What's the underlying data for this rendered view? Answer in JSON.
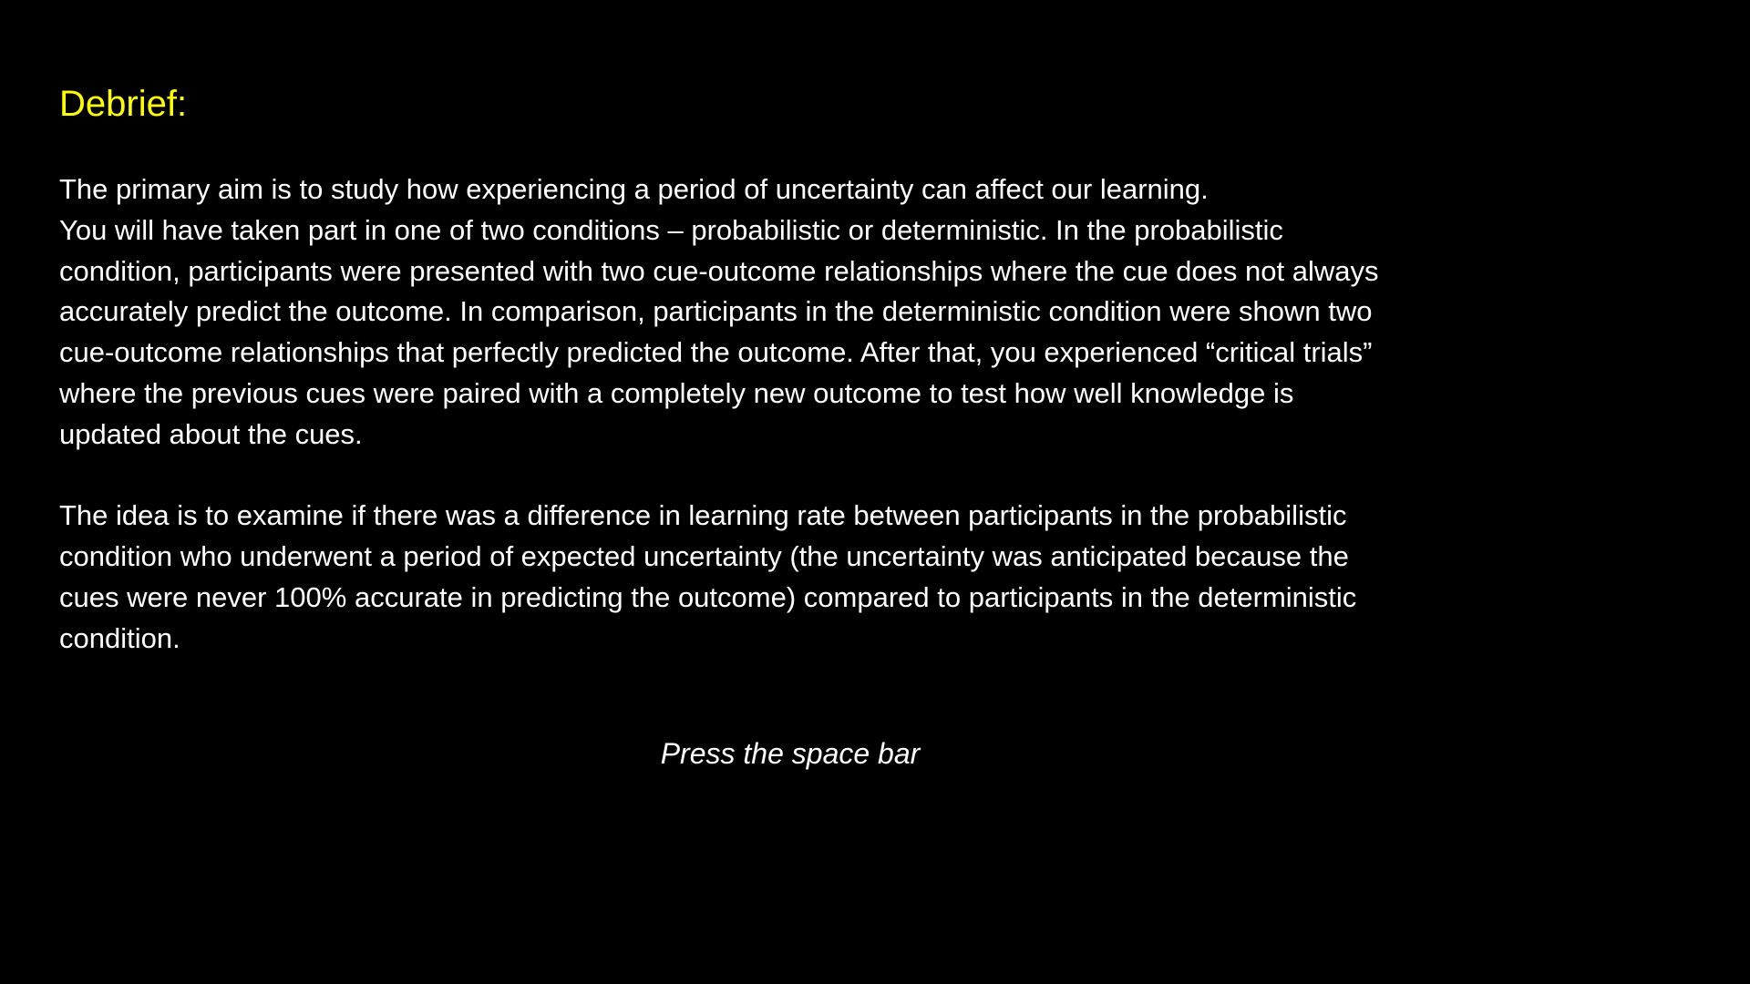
{
  "title": "Debrief:",
  "paragraph1": {
    "lines": [
      "The primary aim is to study how experiencing a period of uncertainty can affect our learning.",
      "You will have taken part in one of two conditions – probabilistic or deterministic. In the probabilistic",
      "condition, participants were presented with two cue-outcome relationships where the cue does not always",
      "accurately predict the outcome. In comparison, participants in the deterministic condition were shown two",
      "cue-outcome relationships that perfectly predicted the outcome. After that, you experienced “critical trials”",
      "where the previous cues were paired with a completely new outcome to test how well knowledge is",
      "updated about the cues."
    ]
  },
  "paragraph2": {
    "lines": [
      "The idea is to examine if there was a difference in learning rate between participants in the probabilistic",
      "condition who underwent a period of expected uncertainty (the uncertainty was anticipated because the",
      "cues were never 100% accurate in predicting the outcome) compared to participants in the deterministic",
      "condition."
    ]
  },
  "prompt": "Press the space bar",
  "colors": {
    "background": "#000000",
    "title": "#ffff00",
    "text": "#ffffff"
  }
}
